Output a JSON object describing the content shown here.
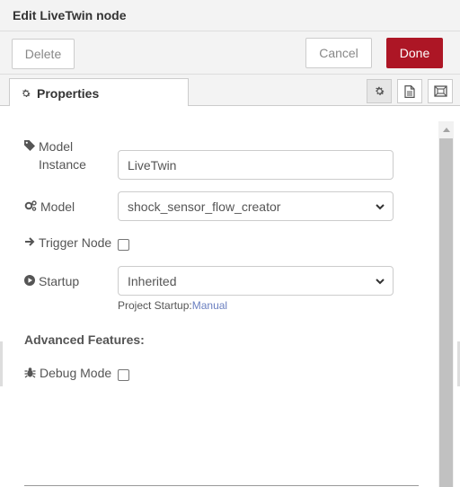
{
  "header": {
    "title": "Edit LiveTwin node"
  },
  "toolbar": {
    "delete_label": "Delete",
    "cancel_label": "Cancel",
    "done_label": "Done"
  },
  "tabs": {
    "properties_label": "Properties"
  },
  "form": {
    "model_instance": {
      "label": "Model Instance",
      "value": "LiveTwin"
    },
    "model": {
      "label": "Model",
      "selected": "shock_sensor_flow_creator"
    },
    "trigger_node": {
      "label": "Trigger Node",
      "checked": false
    },
    "startup": {
      "label": "Startup",
      "selected": "Inherited",
      "hint_prefix": "Project Startup:",
      "hint_value": "Manual"
    },
    "advanced_title": "Advanced Features:",
    "debug_mode": {
      "label": "Debug Mode",
      "checked": false
    }
  },
  "icons": {
    "properties_tab": "gear-icon",
    "node_settings": "gear-icon",
    "description": "document-icon",
    "appearance": "frame-icon",
    "model_instance": "tag-icon",
    "model": "cogs-icon",
    "trigger_node": "arrow-right-icon",
    "startup": "play-circle-icon",
    "debug_mode": "bug-icon"
  },
  "colors": {
    "done_button": "#ad1625",
    "link": "#6a7fc0"
  }
}
